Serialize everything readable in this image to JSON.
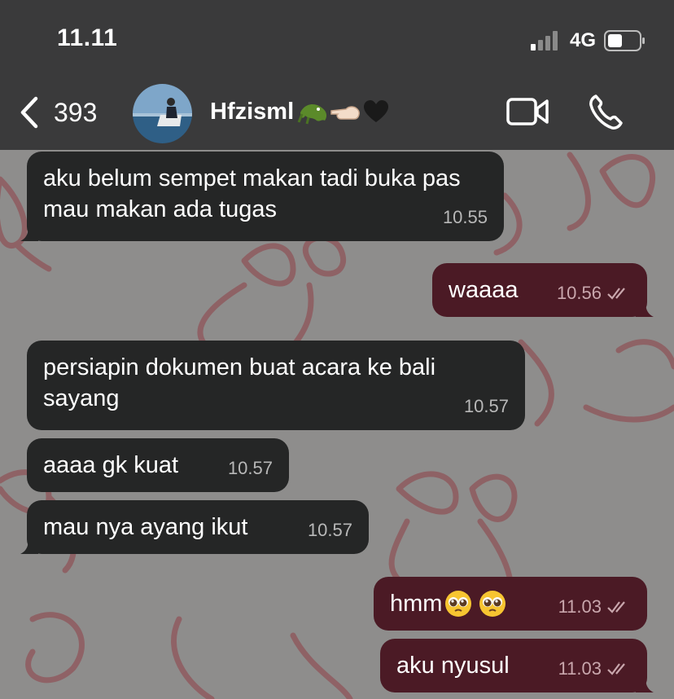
{
  "status_bar": {
    "time": "11.11",
    "network": "4G"
  },
  "header": {
    "back_count": "393",
    "contact_name": "Hfzisml"
  },
  "messages": [
    {
      "direction": "in",
      "text": "aku belum sempet makan tadi buka pas mau makan ada tugas",
      "time": "10.55"
    },
    {
      "direction": "out",
      "text": "waaaa",
      "time": "10.56",
      "read": true
    },
    {
      "direction": "in",
      "text": "persiapin dokumen buat acara ke bali sayang",
      "time": "10.57"
    },
    {
      "direction": "in",
      "text": "aaaa gk kuat",
      "time": "10.57"
    },
    {
      "direction": "in",
      "text": "mau nya ayang ikut",
      "time": "10.57"
    },
    {
      "direction": "out",
      "text": "hmm",
      "time": "11.03",
      "read": true
    },
    {
      "direction": "out",
      "text": "aku nyusul",
      "time": "11.03",
      "read": true
    }
  ],
  "icons": {
    "back": "chevron-left-icon",
    "video": "video-camera-icon",
    "call": "phone-icon",
    "name_emojis": [
      "crocodile-emoji",
      "pointing-hand-emoji",
      "black-heart-emoji"
    ],
    "message_emojis": [
      "pleading-face-emoji",
      "pleading-face-emoji"
    ]
  },
  "colors": {
    "header_bg": "#3a3a3b",
    "incoming_bubble": "#252626",
    "outgoing_bubble": "#4b1a25",
    "wallpaper": "#8e8d8c",
    "ribbon": "#8f5b5f",
    "read_ticks": "#c9a7ad"
  }
}
